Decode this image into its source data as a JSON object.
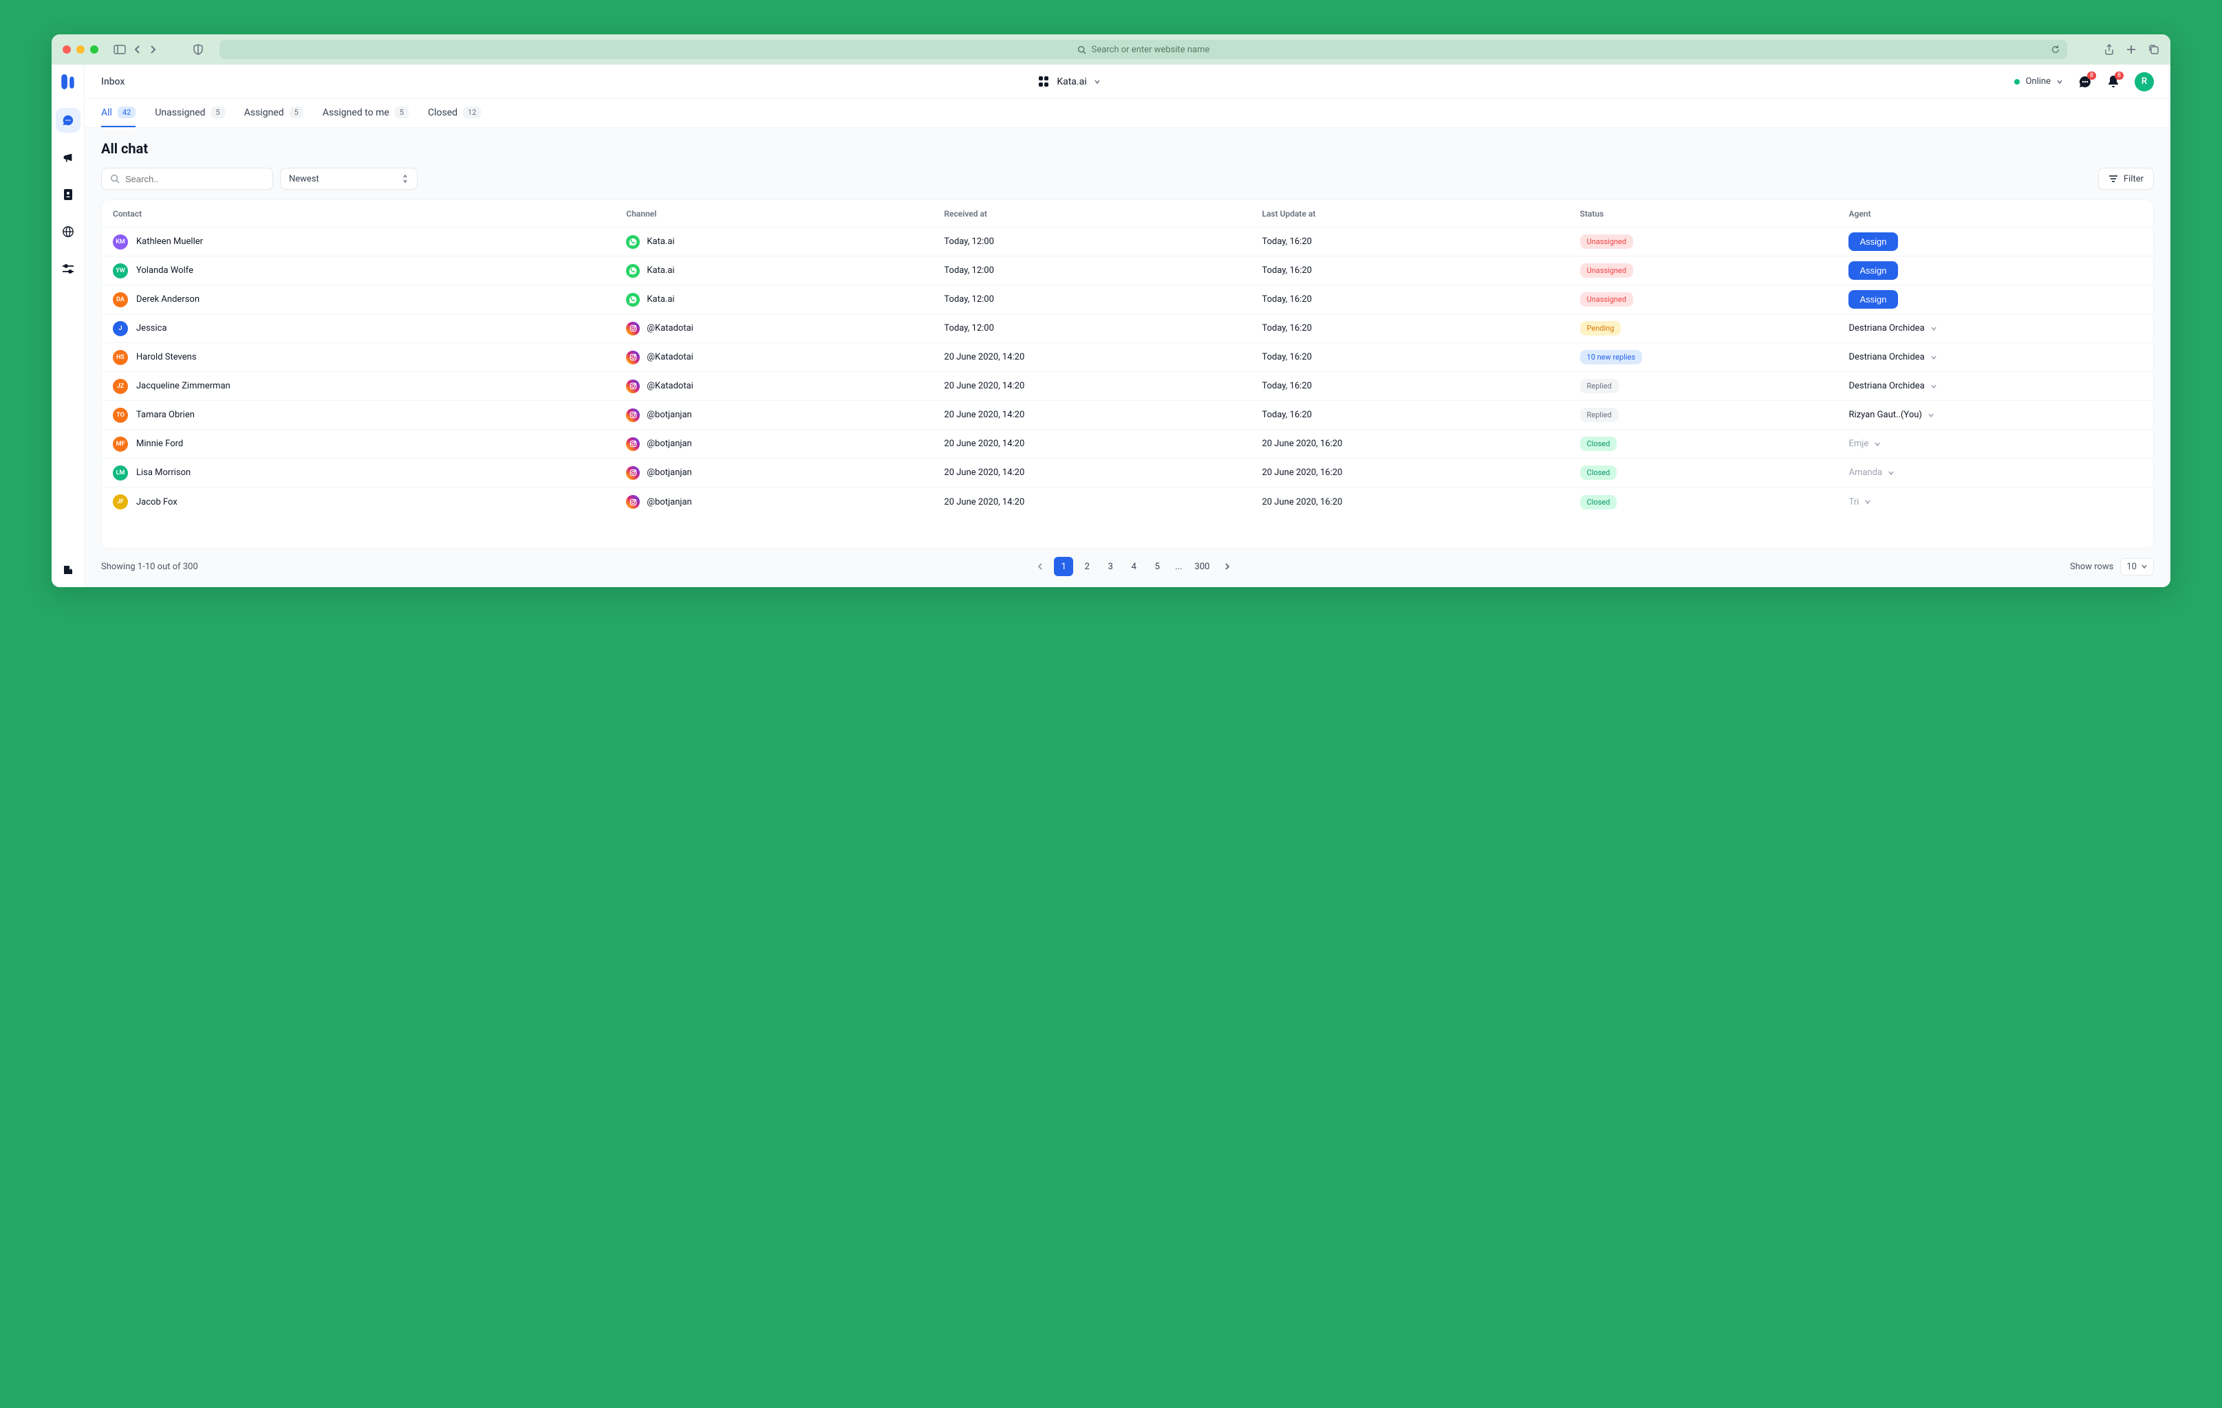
{
  "browser": {
    "url_placeholder": "Search or enter website name"
  },
  "topbar": {
    "page_name": "Inbox",
    "workspace": "Kata.ai",
    "status": "Online",
    "chat_badge": "8",
    "notif_badge": "8",
    "avatar_initial": "R"
  },
  "tabs": [
    {
      "label": "All",
      "count": "42"
    },
    {
      "label": "Unassigned",
      "count": "5"
    },
    {
      "label": "Assigned",
      "count": "5"
    },
    {
      "label": "Assigned to me",
      "count": "5"
    },
    {
      "label": "Closed",
      "count": "12"
    }
  ],
  "page_title": "All chat",
  "toolbar": {
    "search_placeholder": "Search..",
    "sort_value": "Newest",
    "filter_label": "Filter"
  },
  "columns": {
    "contact": "Contact",
    "channel": "Channel",
    "received": "Received at",
    "updated": "Last Update at",
    "status": "Status",
    "agent": "Agent"
  },
  "assign_label": "Assign",
  "rows": [
    {
      "initials": "KM",
      "avatar_bg": "#8b5cf6",
      "name": "Kathleen Mueller",
      "channel_type": "whatsapp",
      "channel": "Kata.ai",
      "received": "Today, 12:00",
      "updated": "Today, 16:20",
      "status": "Unassigned",
      "status_class": "unassigned",
      "agent_type": "assign"
    },
    {
      "initials": "YW",
      "avatar_bg": "#10b981",
      "name": "Yolanda Wolfe",
      "channel_type": "whatsapp",
      "channel": "Kata.ai",
      "received": "Today, 12:00",
      "updated": "Today, 16:20",
      "status": "Unassigned",
      "status_class": "unassigned",
      "agent_type": "assign"
    },
    {
      "initials": "DA",
      "avatar_bg": "#f97316",
      "name": "Derek Anderson",
      "channel_type": "whatsapp",
      "channel": "Kata.ai",
      "received": "Today, 12:00",
      "updated": "Today, 16:20",
      "status": "Unassigned",
      "status_class": "unassigned",
      "agent_type": "assign"
    },
    {
      "initials": "J",
      "avatar_bg": "#2563eb",
      "name": "Jessica",
      "channel_type": "instagram",
      "channel": "@Katadotai",
      "received": "Today, 12:00",
      "updated": "Today, 16:20",
      "status": "Pending",
      "status_class": "pending",
      "agent_type": "select",
      "agent": "Destriana Orchidea"
    },
    {
      "initials": "HS",
      "avatar_bg": "#f97316",
      "name": "Harold Stevens",
      "channel_type": "instagram",
      "channel": "@Katadotai",
      "received": "20 June 2020, 14:20",
      "updated": "Today, 16:20",
      "status": "10 new replies",
      "status_class": "10-new-replies",
      "agent_type": "select",
      "agent": "Destriana Orchidea"
    },
    {
      "initials": "JZ",
      "avatar_bg": "#f97316",
      "name": "Jacqueline Zimmerman",
      "channel_type": "instagram",
      "channel": "@Katadotai",
      "received": "20 June 2020, 14:20",
      "updated": "Today, 16:20",
      "status": "Replied",
      "status_class": "replied",
      "agent_type": "select",
      "agent": "Destriana Orchidea"
    },
    {
      "initials": "TO",
      "avatar_bg": "#f97316",
      "name": "Tamara Obrien",
      "channel_type": "instagram",
      "channel": "@botjanjan",
      "received": "20 June 2020, 14:20",
      "updated": "Today, 16:20",
      "status": "Replied",
      "status_class": "replied",
      "agent_type": "select",
      "agent": "Rizyan Gaut..(You)"
    },
    {
      "initials": "MF",
      "avatar_bg": "#f97316",
      "name": "Minnie Ford",
      "channel_type": "instagram",
      "channel": "@botjanjan",
      "received": "20 June 2020, 14:20",
      "updated": "20 June 2020, 16:20",
      "status": "Closed",
      "status_class": "closed",
      "agent_type": "disabled",
      "agent": "Emje"
    },
    {
      "initials": "LM",
      "avatar_bg": "#10b981",
      "name": "Lisa Morrison",
      "channel_type": "instagram",
      "channel": "@botjanjan",
      "received": "20 June 2020, 14:20",
      "updated": "20 June 2020, 16:20",
      "status": "Closed",
      "status_class": "closed",
      "agent_type": "disabled",
      "agent": "Amanda"
    },
    {
      "initials": "JF",
      "avatar_bg": "#eab308",
      "name": "Jacob Fox",
      "channel_type": "instagram",
      "channel": "@botjanjan",
      "received": "20 June 2020, 14:20",
      "updated": "20 June 2020, 16:20",
      "status": "Closed",
      "status_class": "closed",
      "agent_type": "disabled",
      "agent": "Tri"
    }
  ],
  "footer": {
    "showing": "Showing 1-10 out of 300",
    "pages": [
      "1",
      "2",
      "3",
      "4",
      "5",
      "...",
      "300"
    ],
    "active_page": "1",
    "show_rows_label": "Show rows",
    "rows_value": "10"
  }
}
